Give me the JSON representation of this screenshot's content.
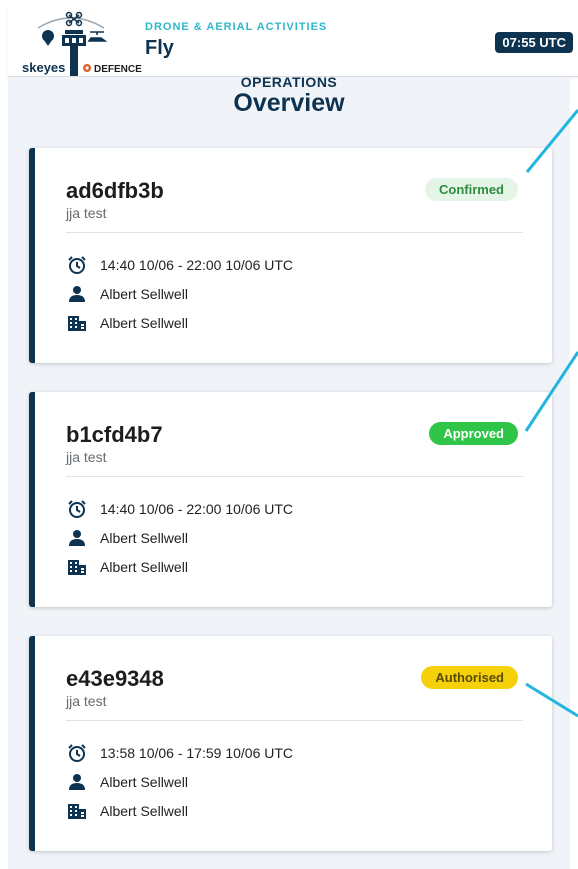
{
  "header": {
    "logo_text": "skeyes",
    "logo_partner": "DEFENCE",
    "subtitle": "DRONE & AERIAL ACTIVITIES",
    "title": "Fly",
    "clock": "07:55 UTC"
  },
  "page": {
    "section": "OPERATIONS",
    "title": "Overview"
  },
  "colors": {
    "navy": "#0d3350",
    "teal_accent": "#2fb8c9",
    "confirmed": "#e4f5e8",
    "approved": "#2ec548",
    "authorised": "#f5d10c"
  },
  "operations": [
    {
      "id": "ad6dfb3b",
      "name": "jja test",
      "status": "Confirmed",
      "time": "14:40 10/06 - 22:00 10/06 UTC",
      "pilot": "Albert Sellwell",
      "organisation": "Albert Sellwell"
    },
    {
      "id": "b1cfd4b7",
      "name": "jja test",
      "status": "Approved",
      "time": "14:40 10/06 - 22:00 10/06 UTC",
      "pilot": "Albert Sellwell",
      "organisation": "Albert Sellwell"
    },
    {
      "id": "e43e9348",
      "name": "jja test",
      "status": "Authorised",
      "time": "13:58 10/06 - 17:59 10/06 UTC",
      "pilot": "Albert Sellwell",
      "organisation": "Albert Sellwell"
    }
  ]
}
